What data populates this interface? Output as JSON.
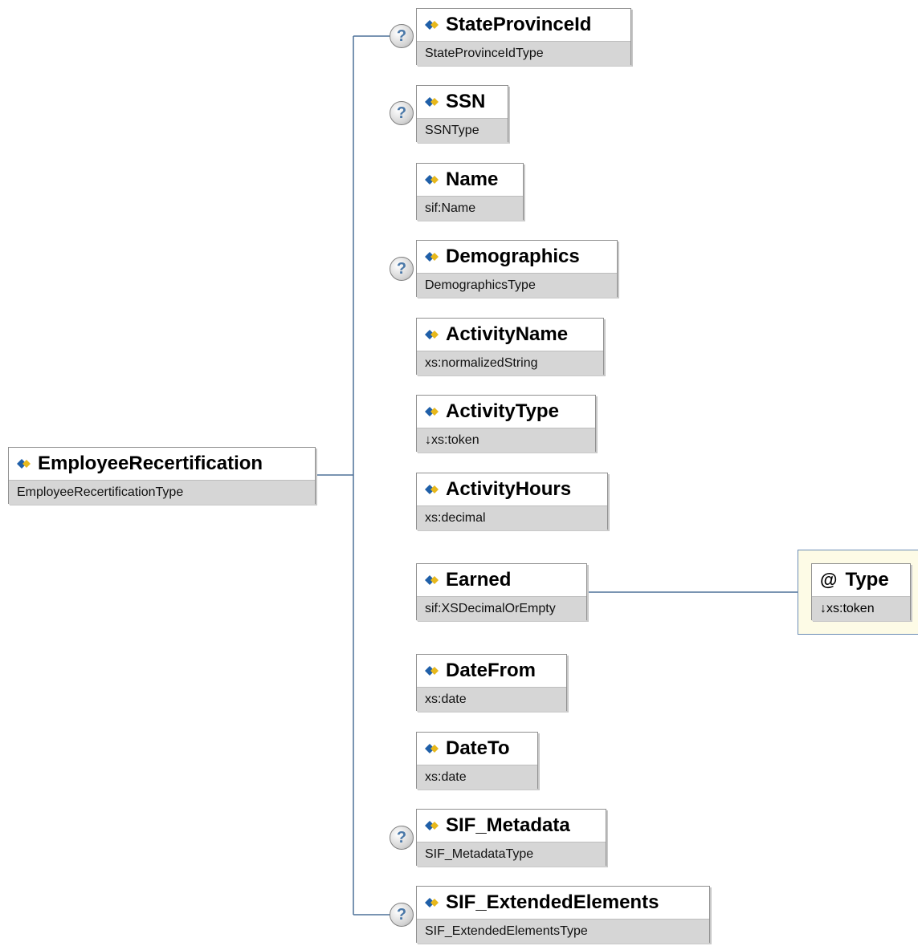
{
  "root": {
    "name": "EmployeeRecertification",
    "type": "EmployeeRecertificationType"
  },
  "elements": [
    {
      "name": "StateProvinceId",
      "type": "StateProvinceIdType",
      "optional": true
    },
    {
      "name": "SSN",
      "type": "SSNType",
      "optional": true
    },
    {
      "name": "Name",
      "type": "sif:Name",
      "optional": false
    },
    {
      "name": "Demographics",
      "type": "DemographicsType",
      "optional": true
    },
    {
      "name": "ActivityName",
      "type": "xs:normalizedString",
      "optional": false
    },
    {
      "name": "ActivityType",
      "type": "↓xs:token",
      "optional": false
    },
    {
      "name": "ActivityHours",
      "type": "xs:decimal",
      "optional": false
    },
    {
      "name": "Earned",
      "type": "sif:XSDecimalOrEmpty",
      "optional": false
    },
    {
      "name": "DateFrom",
      "type": "xs:date",
      "optional": false
    },
    {
      "name": "DateTo",
      "type": "xs:date",
      "optional": false
    },
    {
      "name": "SIF_Metadata",
      "type": "SIF_MetadataType",
      "optional": true
    },
    {
      "name": "SIF_ExtendedElements",
      "type": "SIF_ExtendedElementsType",
      "optional": true
    }
  ],
  "attribute": {
    "symbol": "@",
    "name": "Type",
    "type": "↓xs:token"
  },
  "optional_symbol": "?",
  "colors": {
    "line": "#4d7098",
    "icon_blue": "#1f5fa8",
    "icon_yellow": "#e7b81c"
  }
}
